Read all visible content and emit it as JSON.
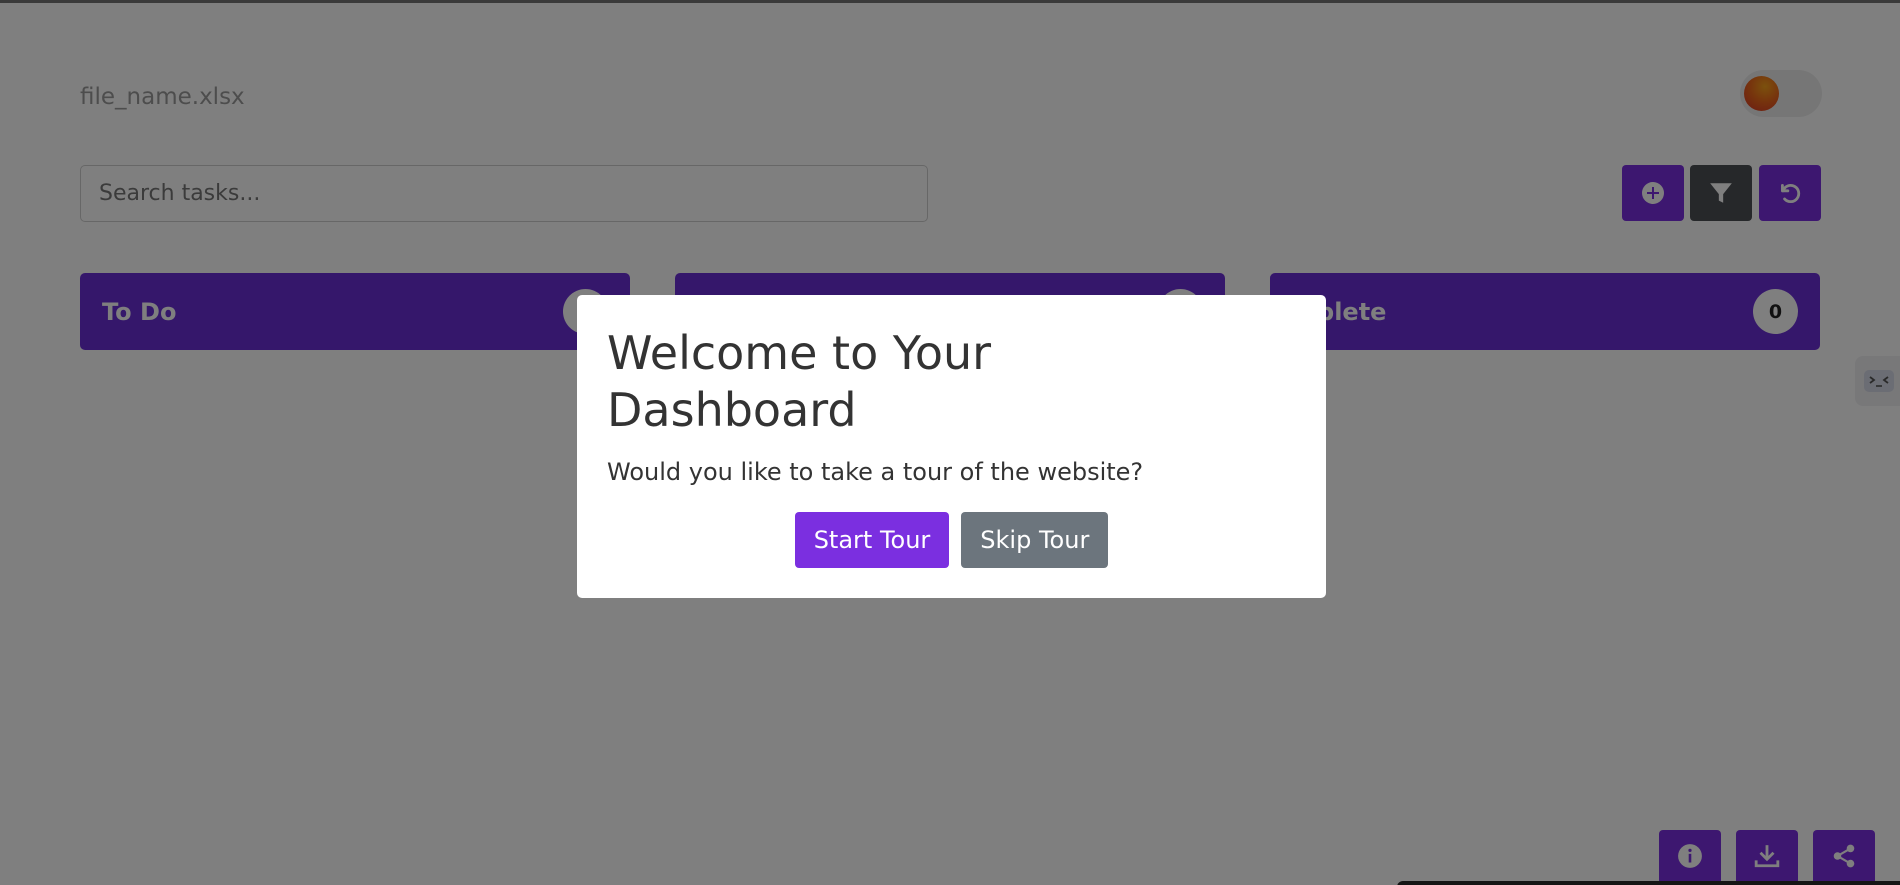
{
  "header": {
    "filename": "file_name.xlsx"
  },
  "search": {
    "placeholder": "Search tasks..."
  },
  "toolbar": {
    "add_icon": "plus-circle-icon",
    "filter_icon": "filter-icon",
    "reset_icon": "undo-icon"
  },
  "columns": [
    {
      "title": "To Do",
      "count": ""
    },
    {
      "title": "",
      "count": ""
    },
    {
      "title": "mplete",
      "count": "0"
    }
  ],
  "bottom_actions": {
    "info_icon": "info-icon",
    "download_icon": "download-icon",
    "share_icon": "share-icon"
  },
  "modal": {
    "title": "Welcome to Your Dashboard",
    "message": "Would you like to take a tour of the website?",
    "start_label": "Start Tour",
    "skip_label": "Skip Tour"
  },
  "colors": {
    "accent": "#7b2fe0",
    "column_header": "#6a2ed6",
    "secondary": "#6c757d"
  }
}
